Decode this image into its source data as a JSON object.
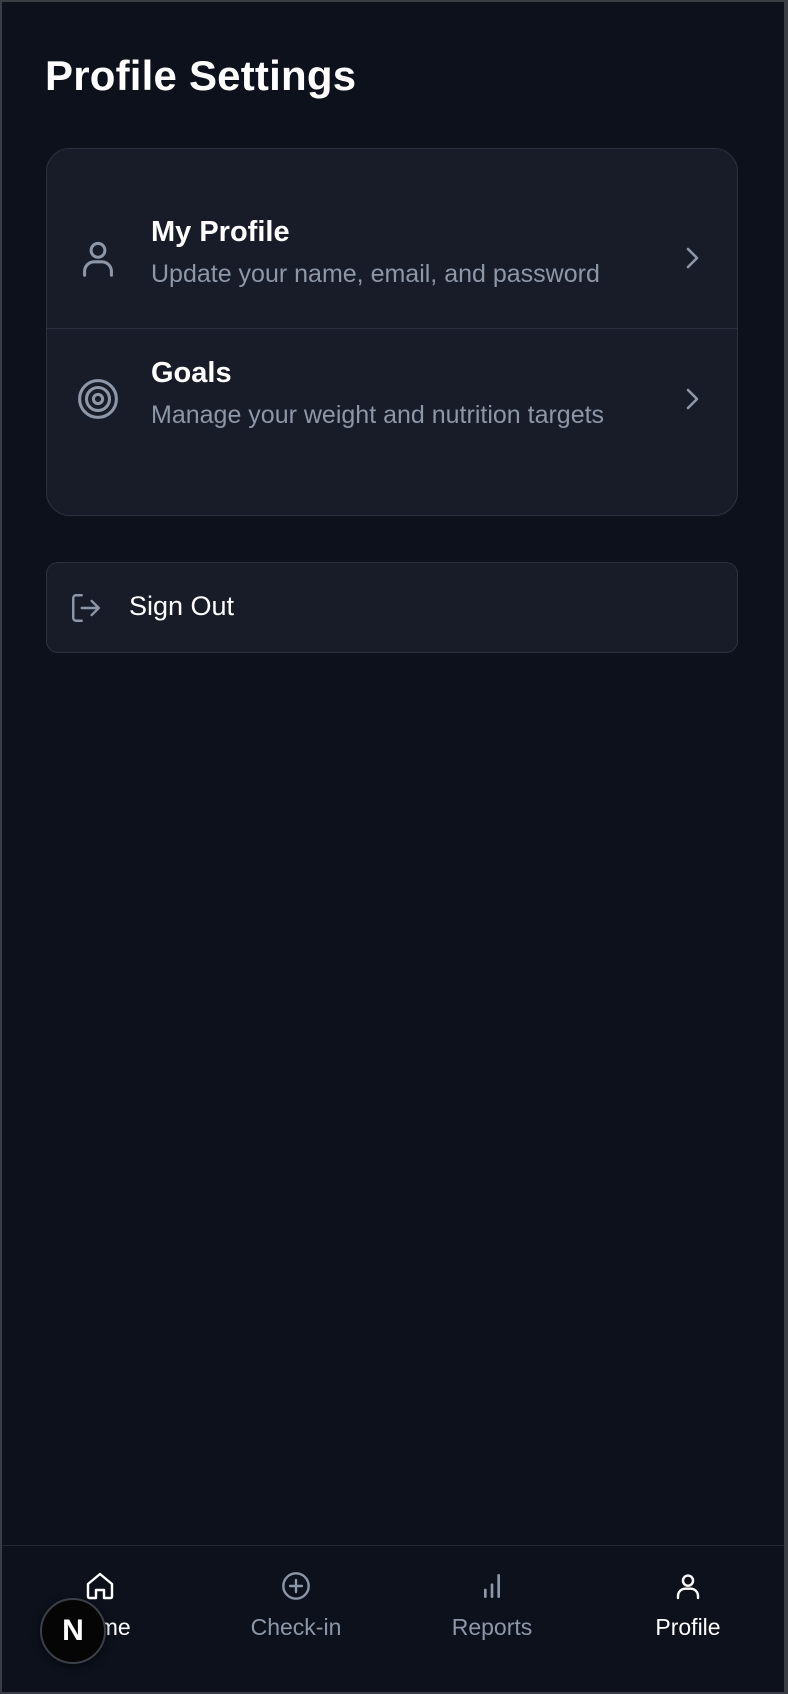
{
  "page": {
    "title": "Profile Settings"
  },
  "menu": {
    "items": [
      {
        "title": "My Profile",
        "subtitle": "Update your name, email, and password",
        "icon": "user-icon"
      },
      {
        "title": "Goals",
        "subtitle": "Manage your weight and nutrition targets",
        "icon": "target-icon"
      }
    ]
  },
  "signout": {
    "label": "Sign Out",
    "icon": "log-out-icon"
  },
  "nav": {
    "items": [
      {
        "label": "Home",
        "icon": "home-icon",
        "active": false
      },
      {
        "label": "Check-in",
        "icon": "plus-circle-icon",
        "active": false
      },
      {
        "label": "Reports",
        "icon": "bar-chart-icon",
        "active": false
      },
      {
        "label": "Profile",
        "icon": "user-icon",
        "active": true
      }
    ]
  },
  "badge": {
    "letter": "N"
  },
  "colors": {
    "background": "#0c111c",
    "card": "#171c28",
    "border": "#2c3240",
    "text_primary": "#ffffff",
    "text_secondary": "#8e97a8"
  }
}
